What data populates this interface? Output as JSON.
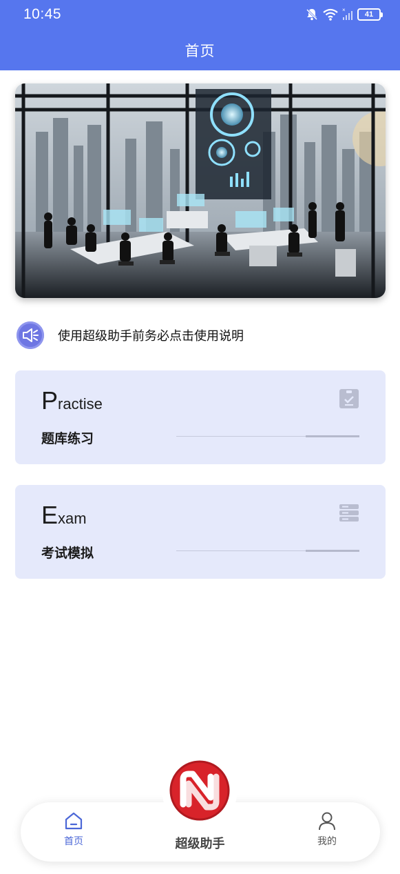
{
  "status_bar": {
    "time": "10:45",
    "battery": "41"
  },
  "header": {
    "title": "首页"
  },
  "notice": {
    "text": "使用超级助手前务必点击使用说明",
    "icon": "speaker-icon"
  },
  "cards": [
    {
      "en_initial": "P",
      "en_rest": "ractise",
      "cn_label": "题库练习",
      "icon": "checklist-icon"
    },
    {
      "en_initial": "E",
      "en_rest": "xam",
      "cn_label": "考试模拟",
      "icon": "stack-icon"
    }
  ],
  "bottom_nav": {
    "home_label": "首页",
    "center_label": "超级助手",
    "mine_label": "我的"
  },
  "colors": {
    "header": "#5676ee",
    "card_bg": "#e5e9fb",
    "nav_active": "#4b67d7",
    "logo_red": "#d8232a"
  }
}
